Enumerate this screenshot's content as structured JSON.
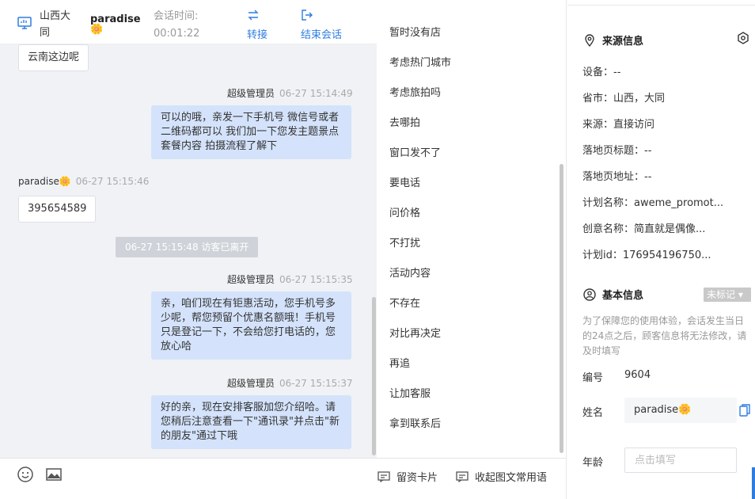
{
  "header": {
    "location": "山西大同",
    "visitor_name": "paradise",
    "visitor_emoji": "🌼",
    "session_label": "会话时间:",
    "session_time": "00:01:22",
    "transfer_label": "转接",
    "end_label": "结束会话"
  },
  "messages": {
    "m1_text": "云南这边呢",
    "m2_sender": "超级管理员",
    "m2_time": "06-27 15:14:49",
    "m2_text": "可以的哦，亲发一下手机号 微信号或者二维码都可以 我们加一下您发主题景点套餐内容 拍摄流程了解下",
    "m3_sender": "paradise🌼",
    "m3_time": "06-27 15:15:46",
    "m3_text": "395654589",
    "sys_notice": "06-27 15:15:48 访客已离开",
    "m4_sender": "超级管理员",
    "m4_time": "06-27 15:15:35",
    "m4_text": "亲，咱们现在有钜惠活动，您手机号多少呢，帮您预留个优惠名额哦！手机号只是登记一下，不会给您打电话的，您放心哈",
    "m5_sender": "超级管理员",
    "m5_time": "06-27 15:15:37",
    "m5_text": "好的亲，现在安排客服加您介绍哈。请您稍后注意查看一下\"通讯录\"并点击\"新的朋友\"通过下哦"
  },
  "quick_replies": [
    "暂时没有店",
    "考虑热门城市",
    "考虑旅拍吗",
    "去哪拍",
    "窗口发不了",
    "要电话",
    "问价格",
    "不打扰",
    "活动内容",
    "不存在",
    "对比再决定",
    "再追",
    "让加客服",
    "拿到联系后"
  ],
  "quick_footer": {
    "card_label": "留资卡片",
    "collapse_label": "收起图文常用语"
  },
  "info": {
    "source_title": "来源信息",
    "device": "设备：--",
    "province": "省市：山西，大同",
    "source": "来源：直接访问",
    "landing_title": "落地页标题：--",
    "landing_url": "落地页地址：--",
    "plan_name": "计划名称：aweme_promot...",
    "creative_name": "创意名称：简直就是偶像...",
    "plan_id": "计划id：176954196750...",
    "basic_title": "基本信息",
    "tag_label": "未标记",
    "notice": "为了保障您的使用体验，会话发生当日的24点之后，顾客信息将无法修改，请及时填写",
    "id_label": "编号",
    "id_value": "9604",
    "name_label": "姓名",
    "name_value": "paradise🌼",
    "age_label": "年龄",
    "age_placeholder": "点击填写"
  }
}
